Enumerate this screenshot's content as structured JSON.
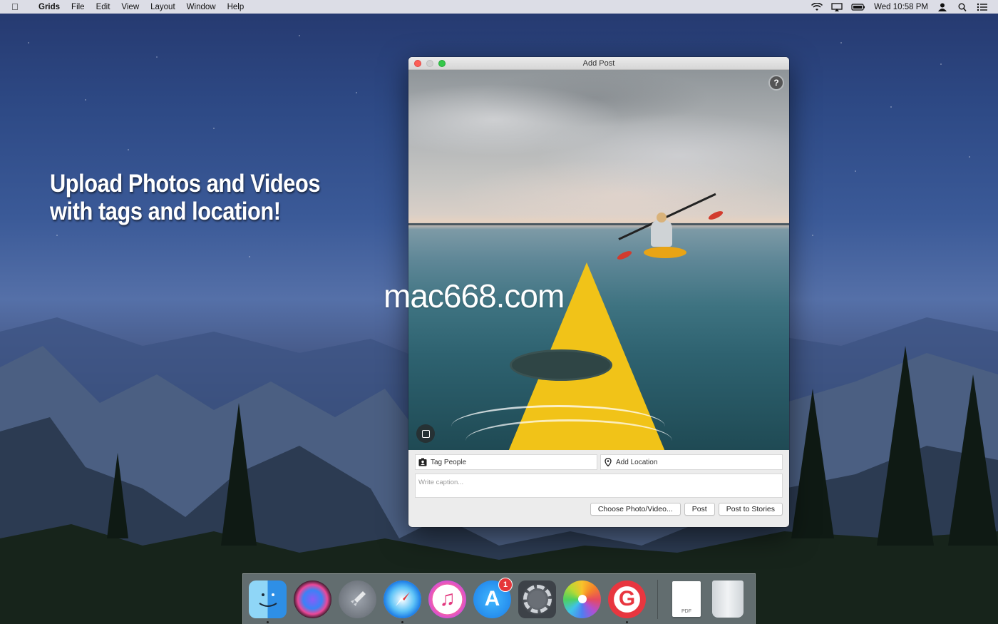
{
  "menubar": {
    "apple_icon": "apple-logo",
    "app_name": "Grids",
    "items": [
      "File",
      "Edit",
      "View",
      "Layout",
      "Window",
      "Help"
    ],
    "status_icons": [
      "wifi-icon",
      "airplay-icon",
      "battery-icon"
    ],
    "clock": "Wed 10:58 PM",
    "user_icon": "user-icon",
    "spotlight_icon": "search-icon",
    "notification_icon": "list-icon"
  },
  "promo": {
    "line1": "Upload Photos and Videos",
    "line2": "with tags and location!"
  },
  "window": {
    "title": "Add Post",
    "help_label": "?",
    "tag_people_label": "Tag People",
    "add_location_label": "Add Location",
    "caption_placeholder": "Write caption...",
    "choose_button": "Choose Photo/Video...",
    "post_button": "Post",
    "stories_button": "Post to Stories"
  },
  "watermark": "mac668.com",
  "dock": {
    "apps": [
      {
        "name": "Finder",
        "icon": "finder-icon",
        "running": true
      },
      {
        "name": "Siri",
        "icon": "siri-icon",
        "running": false
      },
      {
        "name": "Launchpad",
        "icon": "launchpad-icon",
        "running": false
      },
      {
        "name": "Safari",
        "icon": "safari-icon",
        "running": true
      },
      {
        "name": "iTunes",
        "icon": "itunes-icon",
        "running": false
      },
      {
        "name": "App Store",
        "icon": "app-store-icon",
        "running": false,
        "badge": "1"
      },
      {
        "name": "System Preferences",
        "icon": "system-preferences-icon",
        "running": false
      },
      {
        "name": "Photos",
        "icon": "photos-icon",
        "running": false
      },
      {
        "name": "Grids",
        "icon": "grids-icon",
        "running": true
      }
    ],
    "doc_label": "PDF",
    "trash": "trash-icon"
  },
  "colors": {
    "close": "#fc5f57",
    "maximize": "#34c84a",
    "badge": "#e5363a",
    "kayak": "#f1c318"
  }
}
